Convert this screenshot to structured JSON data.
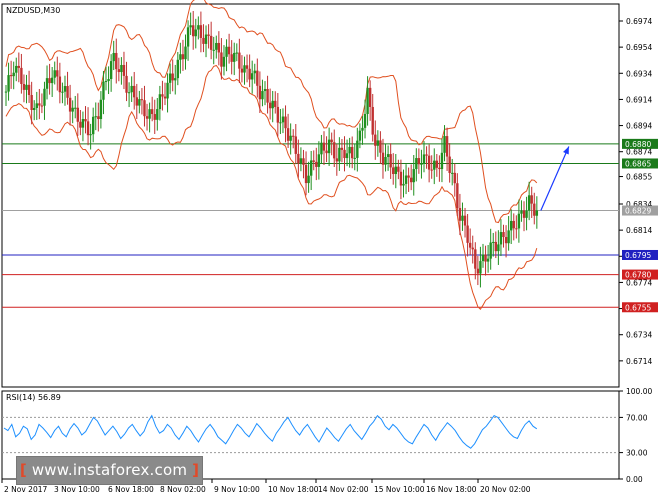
{
  "chart_data": [
    {
      "type": "candlestick",
      "title": "NZDUSD,M30",
      "ylim": [
        0.6694,
        0.6987
      ],
      "y_ticks": [
        "0.6974",
        "0.6954",
        "0.6934",
        "0.6914",
        "0.6894",
        "0.6874",
        "0.6855",
        "0.6834",
        "0.6814",
        "0.6794",
        "0.6774",
        "0.6754",
        "0.6734",
        "0.6714"
      ],
      "x_ticks": [
        "2 Nov 2017",
        "3 Nov 10:00",
        "6 Nov 18:00",
        "8 Nov 02:00",
        "9 Nov 10:00",
        "10 Nov 18:00",
        "14 Nov 02:00",
        "15 Nov 10:00",
        "16 Nov 18:00",
        "20 Nov 02:00"
      ],
      "levels": [
        {
          "value": 0.688,
          "label": "0.6880",
          "color": "#1a7a1a"
        },
        {
          "value": 0.6865,
          "label": "0.6865",
          "color": "#1a7a1a"
        },
        {
          "value": 0.6829,
          "label": "0.6829",
          "color": "#a0a0a0"
        },
        {
          "value": 0.6795,
          "label": "0.6795",
          "color": "#2020c0"
        },
        {
          "value": 0.678,
          "label": "0.6780",
          "color": "#d02020"
        },
        {
          "value": 0.6755,
          "label": "0.6755",
          "color": "#d02020"
        }
      ],
      "price_path": [
        [
          0,
          0.692
        ],
        [
          2,
          0.694
        ],
        [
          4,
          0.693
        ],
        [
          6,
          0.6915
        ],
        [
          8,
          0.6905
        ],
        [
          10,
          0.692
        ],
        [
          12,
          0.6935
        ],
        [
          14,
          0.6925
        ],
        [
          16,
          0.6915
        ],
        [
          18,
          0.6902
        ],
        [
          20,
          0.6895
        ],
        [
          22,
          0.689
        ],
        [
          24,
          0.6905
        ],
        [
          26,
          0.693
        ],
        [
          28,
          0.6945
        ],
        [
          30,
          0.6935
        ],
        [
          32,
          0.692
        ],
        [
          34,
          0.6915
        ],
        [
          36,
          0.6905
        ],
        [
          38,
          0.69
        ],
        [
          40,
          0.6912
        ],
        [
          42,
          0.6925
        ],
        [
          44,
          0.6935
        ],
        [
          46,
          0.695
        ],
        [
          48,
          0.697
        ],
        [
          50,
          0.6965
        ],
        [
          52,
          0.696
        ],
        [
          54,
          0.6955
        ],
        [
          56,
          0.6945
        ],
        [
          58,
          0.695
        ],
        [
          60,
          0.6945
        ],
        [
          62,
          0.6935
        ],
        [
          64,
          0.6935
        ],
        [
          66,
          0.692
        ],
        [
          68,
          0.6915
        ],
        [
          70,
          0.6905
        ],
        [
          72,
          0.6895
        ],
        [
          74,
          0.6885
        ],
        [
          76,
          0.687
        ],
        [
          78,
          0.6855
        ],
        [
          80,
          0.6865
        ],
        [
          82,
          0.6875
        ],
        [
          84,
          0.688
        ],
        [
          86,
          0.687
        ],
        [
          88,
          0.6875
        ],
        [
          90,
          0.687
        ],
        [
          92,
          0.6885
        ],
        [
          94,
          0.6918
        ],
        [
          96,
          0.688
        ],
        [
          98,
          0.687
        ],
        [
          100,
          0.6865
        ],
        [
          102,
          0.6855
        ],
        [
          104,
          0.685
        ],
        [
          106,
          0.686
        ],
        [
          108,
          0.687
        ],
        [
          110,
          0.6865
        ],
        [
          112,
          0.686
        ],
        [
          114,
          0.688
        ],
        [
          116,
          0.6855
        ],
        [
          118,
          0.6825
        ],
        [
          120,
          0.681
        ],
        [
          122,
          0.6785
        ],
        [
          124,
          0.679
        ],
        [
          126,
          0.68
        ],
        [
          128,
          0.6805
        ],
        [
          130,
          0.681
        ],
        [
          132,
          0.6818
        ],
        [
          134,
          0.6825
        ],
        [
          136,
          0.6835
        ],
        [
          138,
          0.6829
        ]
      ],
      "path_x_max": 150,
      "forecast_arrow": {
        "from_value": 0.6829,
        "to_value": 0.6878
      }
    },
    {
      "type": "line",
      "title": "RSI(14) 56.89",
      "ylim": [
        0,
        100
      ],
      "y_ticks": [
        "100.00",
        "70.00",
        "30.00",
        "0.00"
      ],
      "reference_levels": [
        70,
        30
      ],
      "values": [
        58,
        55,
        62,
        48,
        52,
        60,
        57,
        45,
        50,
        62,
        58,
        53,
        47,
        55,
        60,
        52,
        48,
        57,
        63,
        58,
        50,
        54,
        62,
        70,
        66,
        58,
        50,
        55,
        60,
        54,
        46,
        51,
        58,
        62,
        55,
        49,
        54,
        65,
        72,
        60,
        52,
        55,
        62,
        58,
        50,
        45,
        52,
        60,
        55,
        48,
        42,
        50,
        57,
        62,
        56,
        48,
        44,
        40,
        47,
        55,
        62,
        58,
        52,
        48,
        55,
        63,
        58,
        52,
        47,
        43,
        52,
        58,
        65,
        70,
        62,
        55,
        50,
        57,
        62,
        55,
        48,
        42,
        50,
        58,
        53,
        47,
        43,
        50,
        57,
        62,
        55,
        50,
        45,
        52,
        60,
        65,
        72,
        68,
        60,
        56,
        62,
        58,
        52,
        46,
        42,
        40,
        48,
        55,
        62,
        58,
        50,
        44,
        52,
        58,
        64,
        60,
        55,
        48,
        42,
        38,
        35,
        40,
        48,
        56,
        60,
        66,
        72,
        70,
        64,
        58,
        52,
        48,
        46,
        55,
        62,
        66,
        60,
        57
      ]
    }
  ],
  "watermark": {
    "open_bracket": "[",
    "text": " www.instaforex.com",
    "close_bracket": "]"
  }
}
